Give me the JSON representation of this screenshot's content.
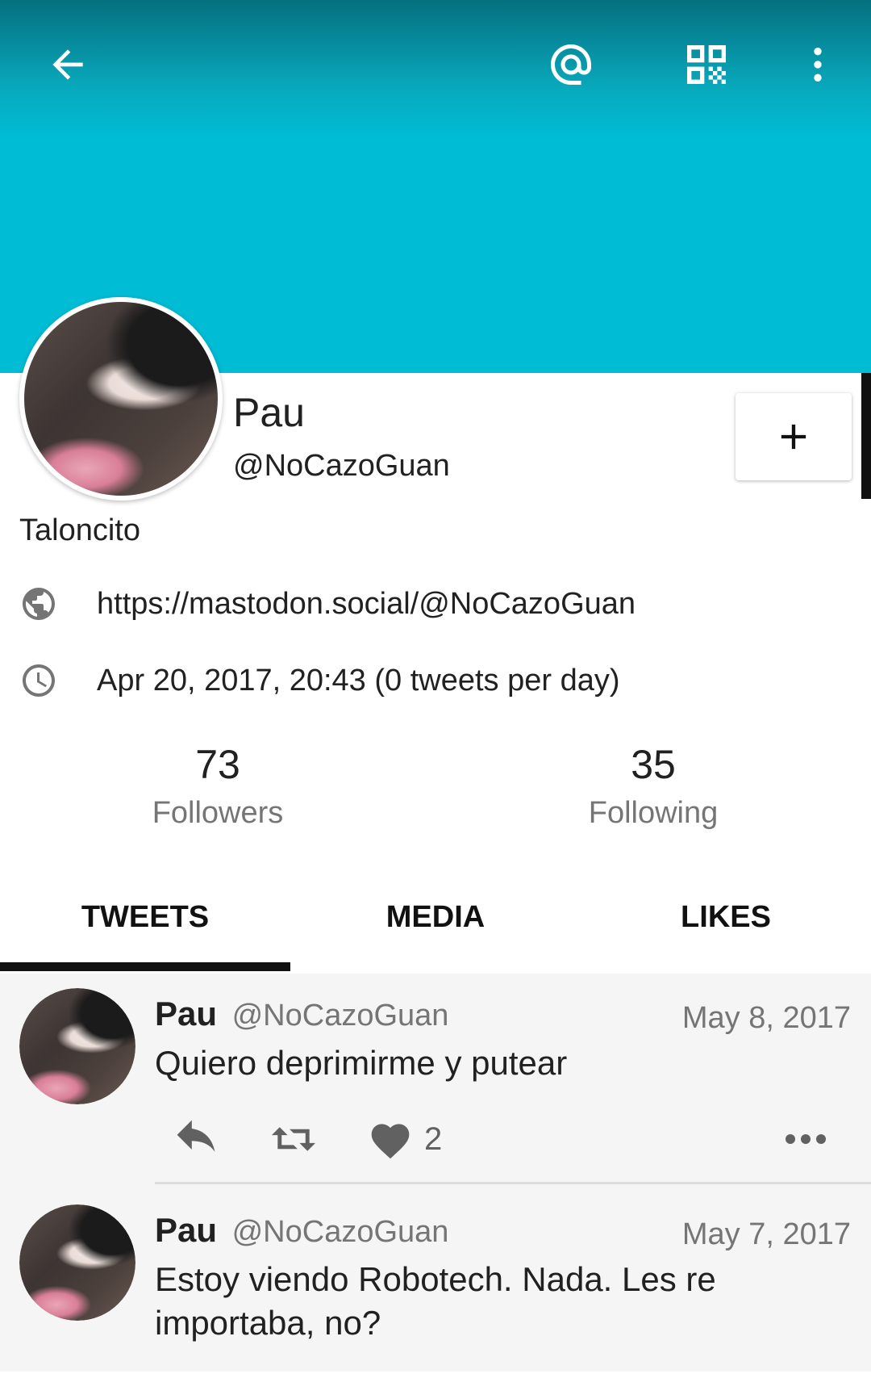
{
  "toolbar": {
    "back_icon": "arrow-left-icon",
    "mention_icon": "at-sign-icon",
    "qr_icon": "qr-code-icon",
    "overflow_icon": "more-vertical-icon"
  },
  "colors": {
    "banner": "#00bcd4",
    "text": "#212121",
    "secondary_text": "#757575",
    "tab_indicator": "#111111"
  },
  "profile": {
    "name": "Pau",
    "handle": "@NoCazoGuan",
    "bio": "Taloncito",
    "url": "https://mastodon.social/@NoCazoGuan",
    "joined": "Apr 20, 2017, 20:43 (0 tweets per day)",
    "follow_button_icon": "plus-icon"
  },
  "stats": {
    "followers_count": "73",
    "followers_label": "Followers",
    "following_count": "35",
    "following_label": "Following"
  },
  "tabs": [
    {
      "label": "TWEETS",
      "selected": true
    },
    {
      "label": "MEDIA",
      "selected": false
    },
    {
      "label": "LIKES",
      "selected": false
    }
  ],
  "tweets": [
    {
      "name": "Pau",
      "handle": "@NoCazoGuan",
      "date": "May 8, 2017",
      "text": "Quiero deprimirme y putear",
      "likes": "2"
    },
    {
      "name": "Pau",
      "handle": "@NoCazoGuan",
      "date": "May 7, 2017",
      "text": "Estoy viendo Robotech. Nada. Les re importaba, no?"
    }
  ]
}
